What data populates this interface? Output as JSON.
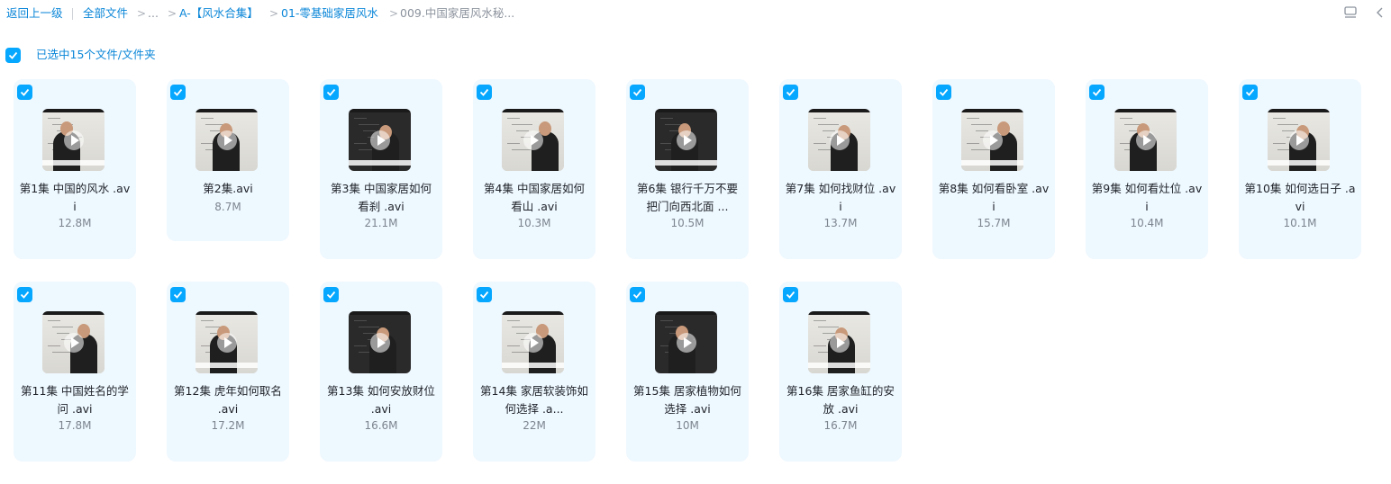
{
  "breadcrumb": {
    "back": "返回上一级",
    "root": "全部文件",
    "ellipsis": "...",
    "seg1": "A-【风水合集】",
    "seg2": "01-零基础家居风水",
    "current": "009.中国家居风水秘..."
  },
  "toolbar": {
    "list_view_icon": "list-view-icon",
    "collapse_icon": "chevron-left-icon"
  },
  "selection": {
    "label": "已选中15个文件/文件夹",
    "checked": true
  },
  "accent_color": "#06a7ff",
  "files": [
    {
      "name": "第1集 中国的风水 .avi",
      "size": "12.8M",
      "thumb": "light"
    },
    {
      "name": "第2集.avi",
      "size": "8.7M",
      "thumb": "light"
    },
    {
      "name": "第3集 中国家居如何看刹 .avi",
      "size": "21.1M",
      "thumb": "dark"
    },
    {
      "name": "第4集 中国家居如何看山 .avi",
      "size": "10.3M",
      "thumb": "light"
    },
    {
      "name": "第6集 银行千万不要把门向西北面 ...",
      "size": "10.5M",
      "thumb": "dark"
    },
    {
      "name": "第7集 如何找财位 .avi",
      "size": "13.7M",
      "thumb": "light"
    },
    {
      "name": "第8集 如何看卧室 .avi",
      "size": "15.7M",
      "thumb": "light"
    },
    {
      "name": "第9集 如何看灶位 .avi",
      "size": "10.4M",
      "thumb": "light"
    },
    {
      "name": "第10集 如何选日子 .avi",
      "size": "10.1M",
      "thumb": "light"
    },
    {
      "name": "第11集 中国姓名的学问 .avi",
      "size": "17.8M",
      "thumb": "light"
    },
    {
      "name": "第12集 虎年如何取名 .avi",
      "size": "17.2M",
      "thumb": "light"
    },
    {
      "name": "第13集 如何安放财位 .avi",
      "size": "16.6M",
      "thumb": "dark"
    },
    {
      "name": "第14集 家居软装饰如何选择 .a...",
      "size": "22M",
      "thumb": "light"
    },
    {
      "name": "第15集 居家植物如何选择 .avi",
      "size": "10M",
      "thumb": "dark"
    },
    {
      "name": "第16集 居家鱼缸的安放 .avi",
      "size": "16.7M",
      "thumb": "light"
    }
  ]
}
